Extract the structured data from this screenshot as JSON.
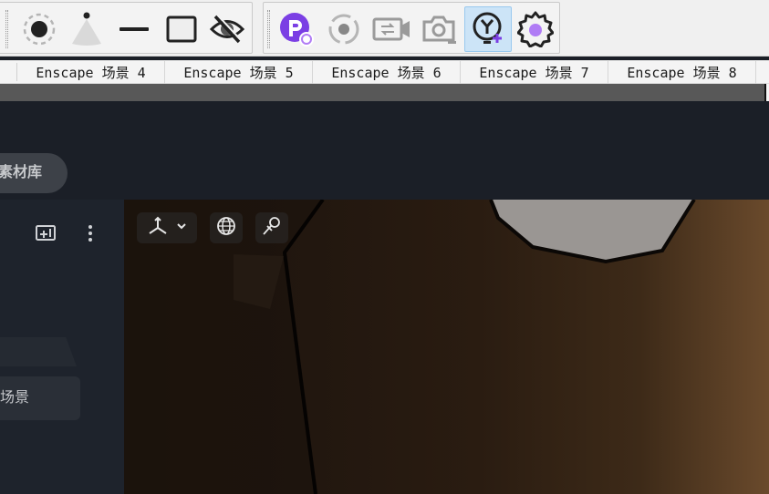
{
  "toolbar": {
    "group1": [
      {
        "icon": "point-light-icon"
      },
      {
        "icon": "spot-light-icon"
      },
      {
        "icon": "line-light-icon"
      },
      {
        "icon": "rectangle-light-icon"
      },
      {
        "icon": "hide-eye-icon"
      }
    ],
    "group2": [
      {
        "icon": "plugin-sync-icon"
      },
      {
        "icon": "orbit-icon"
      },
      {
        "icon": "video-editor-icon"
      },
      {
        "icon": "screenshot-icon"
      },
      {
        "icon": "add-asset-icon",
        "active": true
      },
      {
        "icon": "settings-gear-icon"
      }
    ],
    "colors": {
      "accent_purple": "#7b3fe4",
      "active_bg": "#cce4f7"
    }
  },
  "scene_tabs": [
    "Enscape 场景 4",
    "Enscape 场景 5",
    "Enscape 场景 6",
    "Enscape 场景 7",
    "Enscape 场景 8"
  ],
  "app": {
    "library_button": "素材库",
    "sidebar": {
      "item_label": "场景",
      "icons": [
        "add-screen-icon",
        "more-vertical-icon"
      ]
    },
    "viewport_tools": [
      "axis-gizmo-icon",
      "globe-icon",
      "probe-icon"
    ]
  }
}
